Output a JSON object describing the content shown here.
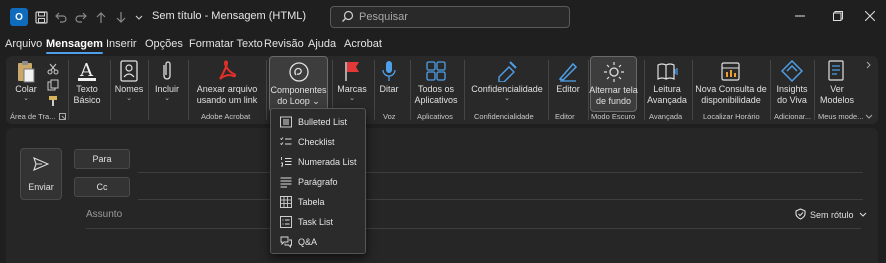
{
  "titlebar": {
    "title": "Sem título  -  Mensagem (HTML)",
    "search_placeholder": "Pesquisar",
    "app_icon_letter": "O",
    "icons": [
      "outlook-icon",
      "save-icon",
      "undo-icon",
      "redo-icon",
      "up-arrow-icon",
      "down-arrow-icon",
      "more-icon"
    ],
    "window_controls": [
      "minimize",
      "maximize",
      "close"
    ]
  },
  "menu": {
    "tabs": [
      "Arquivo",
      "Mensagem",
      "Inserir",
      "Opções",
      "Formatar Texto",
      "Revisão",
      "Ajuda",
      "Acrobat"
    ],
    "active": "Mensagem"
  },
  "ribbon": {
    "colar": "Colar",
    "texto_basico_1": "Texto",
    "texto_basico_2": "Básico",
    "nomes": "Nomes",
    "incluir": "Incluir",
    "anexar_1": "Anexar arquivo",
    "anexar_2": "usando um link",
    "componentes_1": "Componentes",
    "componentes_2": "do Loop",
    "marcas": "Marcas",
    "ditar": "Ditar",
    "todos_1": "Todos os",
    "todos_2": "Aplicativos",
    "confidencialidade": "Confidencialidade",
    "editor": "Editor",
    "alternar_1": "Alternar tela",
    "alternar_2": "de fundo",
    "leitura_1": "Leitura",
    "leitura_2": "Avançada",
    "nova_1": "Nova Consulta de",
    "nova_2": "disponibilidade",
    "insights_1": "Insights",
    "insights_2": "do Viva",
    "ver_1": "Ver",
    "ver_2": "Modelos",
    "groups": {
      "area_transferencia": "Área de Tra...",
      "adobe": "Adobe Acrobat",
      "voz": "Voz",
      "aplicativos": "Aplicativos",
      "confidencialidade": "Confidencialidade",
      "editor": "Editor",
      "modo_escuro": "Modo Escuro",
      "avancada": "Avançada",
      "localizar": "Localizar Horário",
      "adicionar": "Adicionar...",
      "meus_modelos": "Meus mode..."
    }
  },
  "compose": {
    "send": "Enviar",
    "to": "Para",
    "cc": "Cc",
    "subject": "Assunto",
    "sensitivity": "Sem rótulo"
  },
  "loop_dropdown": {
    "items": [
      "Bulleted List",
      "Checklist",
      "Numerada List",
      "Parágrafo",
      "Tabela",
      "Task List",
      "Q&A"
    ],
    "icons": [
      "bulleted-list-icon",
      "checklist-icon",
      "numbered-list-icon",
      "paragraph-icon",
      "table-icon",
      "task-list-icon",
      "qa-icon"
    ]
  },
  "colors": {
    "accent": "#4f9fe8",
    "background": "#1f1f1f",
    "ribbon": "#292929",
    "adobe_red": "#e0302a",
    "flag_red": "#e23838",
    "icon_blue": "#4f9fe8"
  }
}
